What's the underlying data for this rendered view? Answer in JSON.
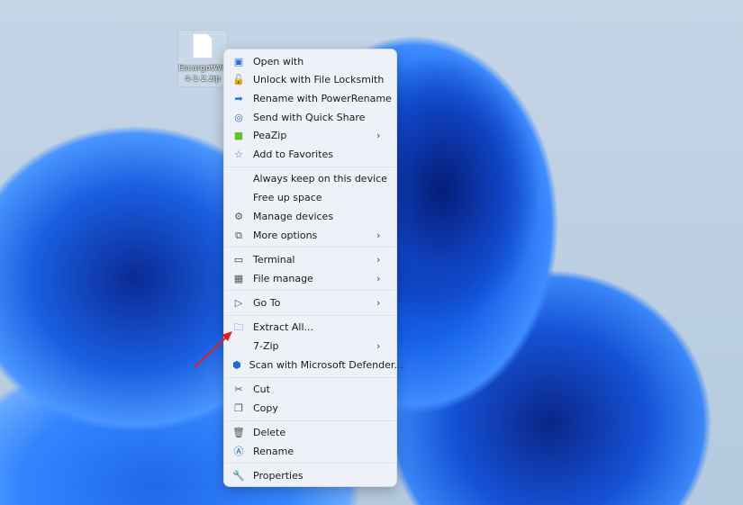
{
  "desktop": {
    "file_icon": {
      "name_line1": "EscargotWin",
      "name_line2": "4-1-2.zip"
    }
  },
  "context_menu": {
    "items": [
      {
        "label": "Open with",
        "icon": "open-with-icon",
        "submenu": false
      },
      {
        "label": "Unlock with File Locksmith",
        "icon": "lock-icon",
        "submenu": false
      },
      {
        "label": "Rename with PowerRename",
        "icon": "power-rename-icon",
        "submenu": false
      },
      {
        "label": "Send with Quick Share",
        "icon": "quick-share-icon",
        "submenu": false
      },
      {
        "label": "PeaZip",
        "icon": "peazip-icon",
        "submenu": true
      },
      {
        "label": "Add to Favorites",
        "icon": "star-icon",
        "submenu": false
      },
      {
        "label": "Always keep on this device",
        "icon": "",
        "submenu": false
      },
      {
        "label": "Free up space",
        "icon": "",
        "submenu": false
      },
      {
        "label": "Manage devices",
        "icon": "gear-icon",
        "submenu": false
      },
      {
        "label": "More options",
        "icon": "more-options-icon",
        "submenu": true
      },
      {
        "label": "Terminal",
        "icon": "terminal-icon",
        "submenu": true
      },
      {
        "label": "File manage",
        "icon": "grid-icon",
        "submenu": true
      },
      {
        "label": "Go To",
        "icon": "play-icon",
        "submenu": true
      },
      {
        "label": "Extract All...",
        "icon": "extract-icon",
        "submenu": false
      },
      {
        "label": "7-Zip",
        "icon": "",
        "submenu": true
      },
      {
        "label": "Scan with Microsoft Defender...",
        "icon": "defender-icon",
        "submenu": false
      },
      {
        "label": "Cut",
        "icon": "scissors-icon",
        "submenu": false
      },
      {
        "label": "Copy",
        "icon": "copy-icon",
        "submenu": false
      },
      {
        "label": "Delete",
        "icon": "trash-icon",
        "submenu": false
      },
      {
        "label": "Rename",
        "icon": "rename-icon",
        "submenu": false
      },
      {
        "label": "Properties",
        "icon": "wrench-icon",
        "submenu": false
      }
    ]
  },
  "colors": {
    "accent": "#0067c0",
    "annotation_arrow": "#e02020",
    "wallpaper": "#1a5ee0"
  }
}
